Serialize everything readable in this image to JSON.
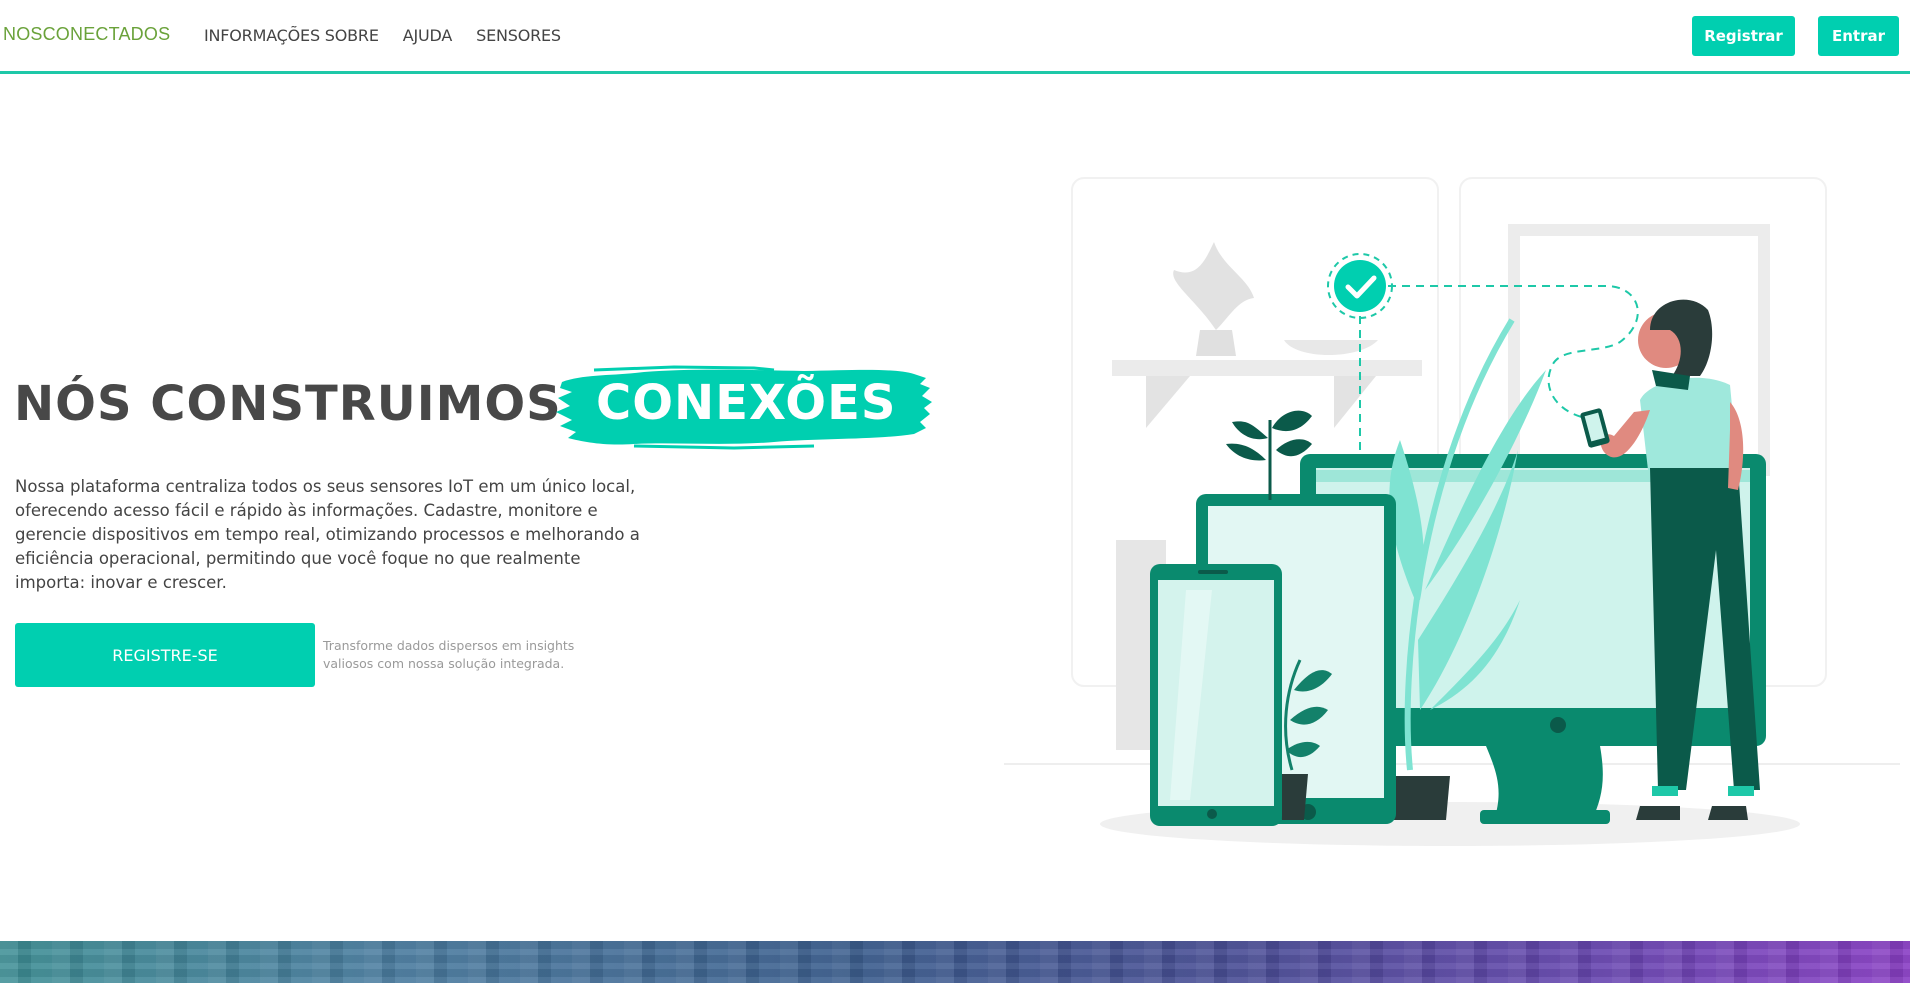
{
  "header": {
    "brand": "NOSCONECTADOS",
    "nav": [
      {
        "label": "INFORMAÇÕES SOBRE"
      },
      {
        "label": "AJUDA"
      },
      {
        "label": "SENSORES"
      }
    ],
    "register_label": "Registrar",
    "login_label": "Entrar"
  },
  "hero": {
    "title": "NÓS CONSTRUIMOS",
    "highlight": "CONEXÕES",
    "description": "Nossa plataforma centraliza todos os seus sensores IoT em um único local, oferecendo acesso fácil e rápido às informações. Cadastre, monitore e gerencie dispositivos em tempo real, otimizando processos e melhorando a eficiência operacional, permitindo que você foque no que realmente importa: inovar e crescer.",
    "cta_label": "REGISTRE-SE",
    "cta_note": "Transforme dados dispersos em insights valiosos com nossa solução integrada."
  },
  "colors": {
    "accent": "#00cfb0",
    "brand": "#6aa23a",
    "text": "#484848",
    "dark_green": "#0b6b55"
  },
  "icons": {
    "check": "check-circle-icon"
  }
}
